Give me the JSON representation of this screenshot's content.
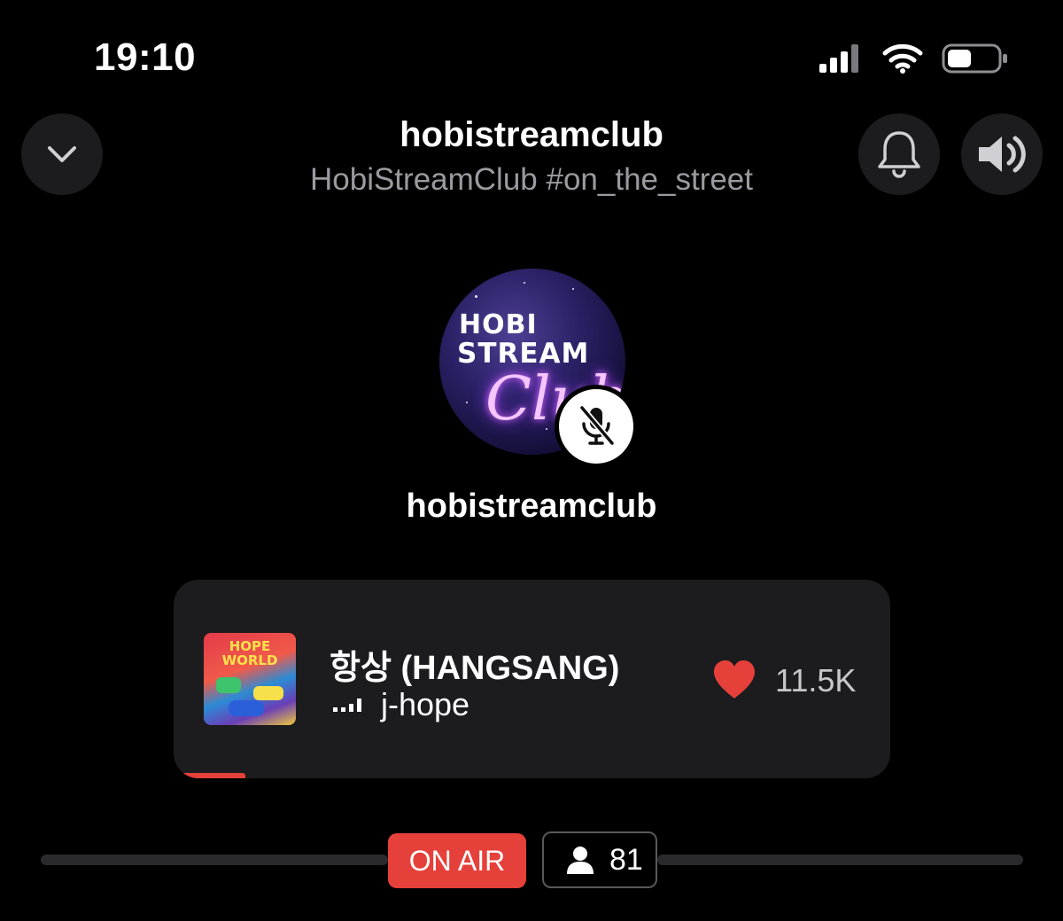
{
  "status_bar": {
    "time": "19:10"
  },
  "header": {
    "title": "hobistreamclub",
    "subtitle": "HobiStreamClub #on_the_street",
    "collapse_icon": "chevron-down-icon",
    "notify_icon": "bell-icon",
    "volume_icon": "speaker-icon"
  },
  "host": {
    "name": "hobistreamclub",
    "avatar_text": [
      "HOBI",
      "STREAM",
      "Club"
    ],
    "mic_status_icon": "mic-muted-icon"
  },
  "now_playing": {
    "title": "항상 (HANGSANG)",
    "artist": "j-hope",
    "likes": "11.5K",
    "album_art_text": [
      "HOPE",
      "WORLD"
    ],
    "progress": 0.1
  },
  "live": {
    "badge": "ON AIR",
    "listener_count": "81"
  },
  "colors": {
    "accent": "#e6403a",
    "card": "#1c1c1e",
    "background": "#000000",
    "muted_text": "#9a9aa0"
  }
}
